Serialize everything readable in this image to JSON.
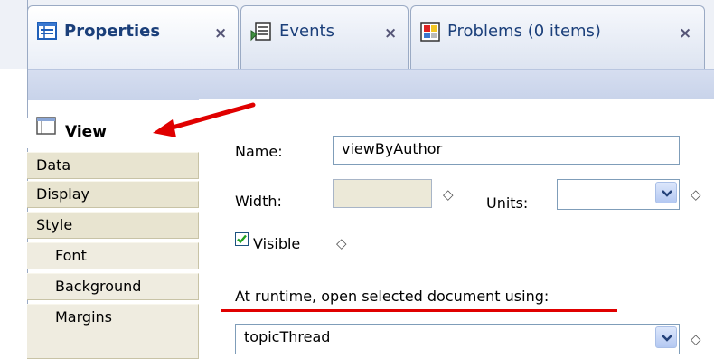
{
  "tabs": [
    {
      "label": "Properties",
      "close": "×"
    },
    {
      "label": "Events",
      "close": "×"
    },
    {
      "label": "Problems (0 items)",
      "close": "×"
    }
  ],
  "sidebar": {
    "items": [
      {
        "label": "View"
      },
      {
        "label": "Data"
      },
      {
        "label": "Display"
      },
      {
        "label": "Style"
      },
      {
        "label": "Font"
      },
      {
        "label": "Background"
      },
      {
        "label": "Margins"
      }
    ]
  },
  "form": {
    "name_label": "Name:",
    "name_value": "viewByAuthor",
    "width_label": "Width:",
    "width_value": "",
    "units_label": "Units:",
    "units_value": "",
    "visible_label": "Visible",
    "visible_checked": true,
    "runtime_label": "At runtime, open selected document using:",
    "runtime_value": "topicThread",
    "diamond": "◇"
  },
  "colors": {
    "annotation_red": "#e00000",
    "tab_text": "#1b3f7a"
  }
}
